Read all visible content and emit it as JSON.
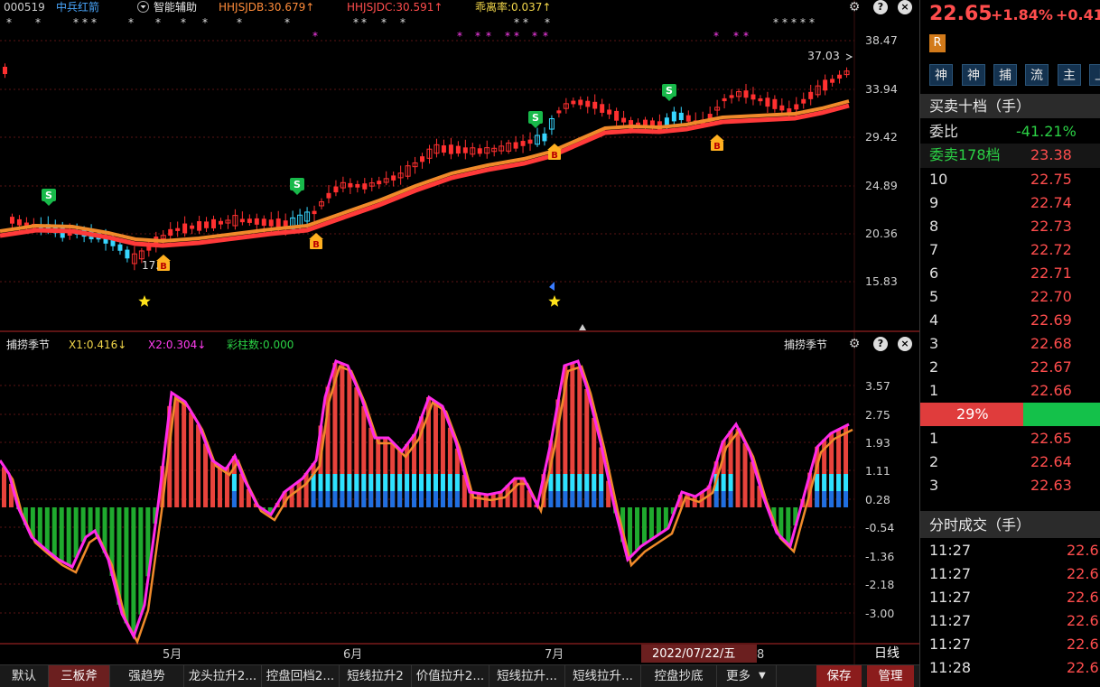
{
  "header": {
    "code": "000519",
    "name": "中兵红箭",
    "assist_label": "智能辅助",
    "hhjsjdb": "HHJSJDB:30.679↑",
    "hhjsjdc": "HHJSJDC:30.591↑",
    "ratio": "乖离率:0.037↑"
  },
  "price_axis": [
    "38.47",
    "33.94",
    "29.42",
    "24.89",
    "20.36",
    "15.83"
  ],
  "price_annot": "37.03",
  "price_low_annot": "17.",
  "indicator": {
    "name": "捕捞季节",
    "x1": "X1:0.416↓",
    "x2": "X2:0.304↓",
    "bars": "彩柱数:0.000",
    "name_right": "捕捞季节"
  },
  "ind_axis": [
    "3.57",
    "2.75",
    "1.93",
    "1.11",
    "0.28",
    "-0.54",
    "-1.36",
    "-2.18",
    "-3.00"
  ],
  "time_axis": {
    "may": "5月",
    "jun": "6月",
    "jul": "7月",
    "aug": "8",
    "date": "2022/07/22/五",
    "period": "日线"
  },
  "tabs": [
    "默认",
    "三板斧",
    "强趋势",
    "龙头拉升2...",
    "控盘回档2...",
    "短线拉升2",
    "价值拉升2...",
    "短线拉升...",
    "短线拉升...",
    "控盘抄底",
    "更多"
  ],
  "buttons": {
    "save": "保存",
    "manage": "管理"
  },
  "quote": {
    "price": "22.65",
    "change_pct": "+1.84%",
    "change": "+0.41",
    "badge": "R",
    "quick": [
      "神",
      "神",
      "捕",
      "流",
      "主",
      "上"
    ]
  },
  "order_book": {
    "title": "买卖十档（手）",
    "weibi_label": "委比",
    "weibi_value": "-41.21%",
    "weimai_label": "委卖178档",
    "weimai_value": "23.38",
    "asks": [
      {
        "level": "10",
        "price": "22.75"
      },
      {
        "level": "9",
        "price": "22.74"
      },
      {
        "level": "8",
        "price": "22.73"
      },
      {
        "level": "7",
        "price": "22.72"
      },
      {
        "level": "6",
        "price": "22.71"
      },
      {
        "level": "5",
        "price": "22.70"
      },
      {
        "level": "4",
        "price": "22.69"
      },
      {
        "level": "3",
        "price": "22.68"
      },
      {
        "level": "2",
        "price": "22.67"
      },
      {
        "level": "1",
        "price": "22.66"
      }
    ],
    "ratio": "29%",
    "bids": [
      {
        "level": "1",
        "price": "22.65"
      },
      {
        "level": "2",
        "price": "22.64"
      },
      {
        "level": "3",
        "price": "22.63"
      }
    ]
  },
  "trades": {
    "title": "分时成交（手）",
    "rows": [
      {
        "time": "11:27",
        "price": "22.6"
      },
      {
        "time": "11:27",
        "price": "22.6"
      },
      {
        "time": "11:27",
        "price": "22.6"
      },
      {
        "time": "11:27",
        "price": "22.6"
      },
      {
        "time": "11:27",
        "price": "22.6"
      },
      {
        "time": "11:28",
        "price": "22.6"
      }
    ]
  }
}
